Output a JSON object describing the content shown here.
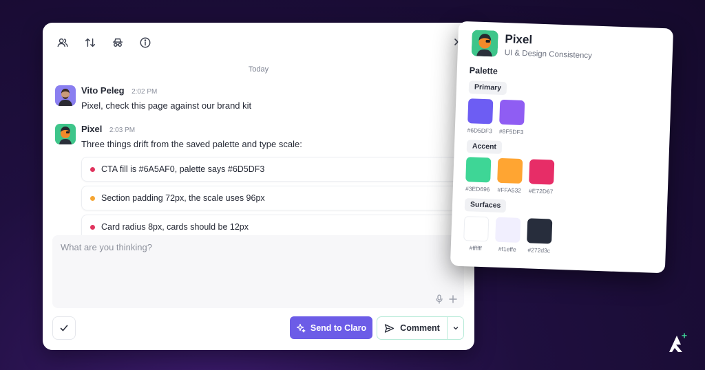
{
  "toolbar": {
    "icons": [
      "users-icon",
      "sort-icon",
      "incognito-icon",
      "info-icon"
    ]
  },
  "conversation": {
    "day_label": "Today",
    "messages": [
      {
        "author": "Vito Peleg",
        "time": "2:02 PM",
        "text": "Pixel, check this page against our brand kit"
      },
      {
        "author": "Pixel",
        "time": "2:03 PM",
        "text": "Three things drift from the saved palette and type scale:"
      }
    ],
    "findings": [
      {
        "text": "CTA fill is #6A5AF0, palette says #6D5DF3",
        "dot_color": "#e0345e"
      },
      {
        "text": "Section padding 72px, the scale uses 96px",
        "dot_color": "#f5a532"
      },
      {
        "text": "Card radius 8px, cards should be 12px",
        "dot_color": "#e0345e"
      }
    ]
  },
  "composer": {
    "placeholder": "What are you thinking?",
    "value": ""
  },
  "actions": {
    "send_label": "Send to Claro",
    "comment_label": "Comment"
  },
  "palette_card": {
    "name": "Pixel",
    "subtitle": "UI & Design Consistency",
    "heading": "Palette",
    "groups": [
      {
        "label": "Primary",
        "swatches": [
          {
            "hex": "#6D5DF3",
            "color": "#6D5DF3"
          },
          {
            "hex": "#8F5DF3",
            "color": "#8F5DF3"
          }
        ]
      },
      {
        "label": "Accent",
        "swatches": [
          {
            "hex": "#3ED696",
            "color": "#3ED696"
          },
          {
            "hex": "#FFA532",
            "color": "#FFA532"
          },
          {
            "hex": "#E72D67",
            "color": "#E72D67"
          }
        ]
      },
      {
        "label": "Surfaces",
        "swatches": [
          {
            "hex": "#ffffff",
            "color": "#ffffff"
          },
          {
            "hex": "#f1effe",
            "color": "#f1effe"
          },
          {
            "hex": "#272d3c",
            "color": "#272d3c"
          }
        ]
      }
    ]
  },
  "colors": {
    "accent": "#6c5ce7",
    "comment_border": "#b7ead8"
  }
}
